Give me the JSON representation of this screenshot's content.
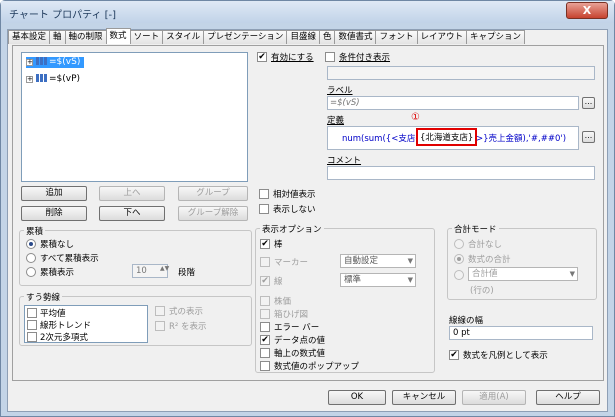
{
  "window": {
    "title": "チャート プロパティ [-]",
    "close": "X"
  },
  "tabs": [
    "基本設定",
    "軸",
    "軸の制限",
    "数式",
    "ソート",
    "スタイル",
    "プレゼンテーション",
    "目盛線",
    "色",
    "数値書式",
    "フォント",
    "レイアウト",
    "キャプション"
  ],
  "expressions": [
    {
      "label": "=$(vS)"
    },
    {
      "label": "=$(vP)"
    }
  ],
  "buttons": {
    "add": "追加",
    "up": "上へ",
    "group": "グループ",
    "delete": "削除",
    "down": "下へ",
    "ungroup": "グループ解除",
    "ok": "OK",
    "cancel": "キャンセル",
    "apply": "適用(A)",
    "help": "ヘルプ"
  },
  "enable": {
    "label": "有効にする"
  },
  "conditional": {
    "label": "条件付き表示"
  },
  "label_section": {
    "title": "ラベル",
    "value": "=$(vS)",
    "btn": "..."
  },
  "definition": {
    "title": "定義",
    "pre": "num(sum({<支店名=",
    "highlight": "{北海道支店}",
    "post": ">}売上金額),'#,##0')",
    "marker": "①",
    "btn": "..."
  },
  "comment": {
    "title": "コメント"
  },
  "accumulation": {
    "title": "累積",
    "opt1": "累積なし",
    "opt2": "すべて累積表示",
    "opt3": "累積表示",
    "steps": "10",
    "steps_label": "段階"
  },
  "trendlines": {
    "title": "すう勢線",
    "items": [
      "平均値",
      "線形トレンド",
      "2次元多項式"
    ]
  },
  "show_equation": "式の表示",
  "show_r2": "R² を表示",
  "relative": "相対値表示",
  "invisible": "表示しない",
  "display_options": {
    "title": "表示オプション",
    "bar": "棒",
    "marker": "マーカー",
    "line": "線",
    "stock": "株価",
    "box": "箱ひげ図",
    "error": "エラー バー",
    "values": "データ点の値",
    "axis_values": "軸上の数式値",
    "popup": "数式値のポップアップ",
    "marker_select": "自動設定",
    "line_select": "標準"
  },
  "total_mode": {
    "title": "合計モード",
    "none": "合計なし",
    "expr": "数式の合計",
    "select": "合計値",
    "rows": "(行の)"
  },
  "line_width": {
    "title": "線線の幅",
    "value": "0 pt"
  },
  "legend_expr": "数式を凡例として表示"
}
